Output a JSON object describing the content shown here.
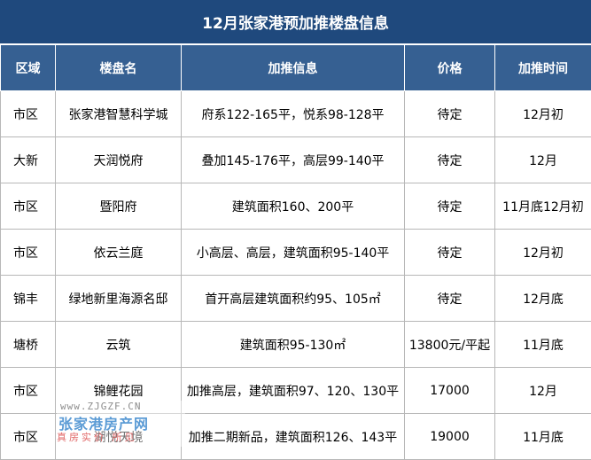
{
  "title": "12月张家港预加推楼盘信息",
  "headers": [
    "区域",
    "楼盘名",
    "加推信息",
    "价格",
    "加推时间"
  ],
  "rows": [
    {
      "region": "市区",
      "name": "张家港智慧科学城",
      "info": "府系122-165平，悦系98-128平",
      "price": "待定",
      "time": "12月初"
    },
    {
      "region": "大新",
      "name": "天润悦府",
      "info": "叠加145-176平，高层99-140平",
      "price": "待定",
      "time": "12月"
    },
    {
      "region": "市区",
      "name": "暨阳府",
      "info": "建筑面积160、200平",
      "price": "待定",
      "time": "11月底12月初"
    },
    {
      "region": "市区",
      "name": "依云兰庭",
      "info": "小高层、高层，建筑面积95-140平",
      "price": "待定",
      "time": "12月初"
    },
    {
      "region": "锦丰",
      "name": "绿地新里海源名邸",
      "info": "首开高层建筑面积约95、105㎡",
      "price": "待定",
      "time": "12月底"
    },
    {
      "region": "塘桥",
      "name": "云筑",
      "info": "建筑面积95-130㎡",
      "price": "13800元/平起",
      "time": "11月底"
    },
    {
      "region": "市区",
      "name": "锦鲤花园",
      "info": "加推高层，建筑面积97、120、130平",
      "price": "17000",
      "time": "12月"
    },
    {
      "region": "市区",
      "name": "湖悦天境",
      "info": "加推二期新品，建筑面积126、143平",
      "price": "19000",
      "time": "11月底"
    }
  ],
  "watermark": {
    "url": "www.ZJGZF.CN",
    "brand": "张家港房产网",
    "slogan": "真房实价 所见"
  },
  "colors": {
    "title_bg": "#1f497d",
    "header_bg": "#366092",
    "grid_line": "#b7b7b7"
  }
}
